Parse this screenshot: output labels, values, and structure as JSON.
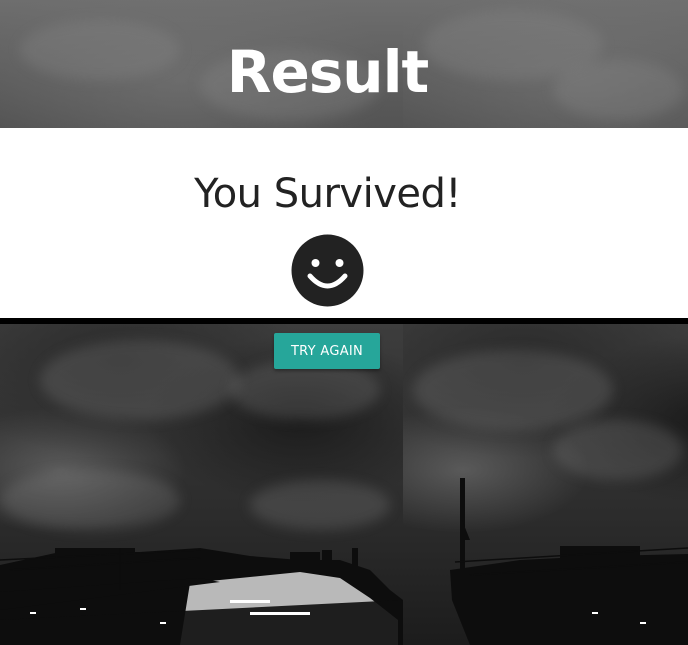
{
  "header": {
    "title": "Result"
  },
  "result": {
    "message": "You Survived!",
    "face": "smiley-face-icon"
  },
  "actions": {
    "try_again_label": "TRY AGAIN"
  },
  "background": {
    "image": "stormy-sky-ship-photo"
  },
  "colors": {
    "button": "#26a69a",
    "panel": "#ffffff",
    "text": "#222222",
    "header_text": "#ffffff"
  }
}
